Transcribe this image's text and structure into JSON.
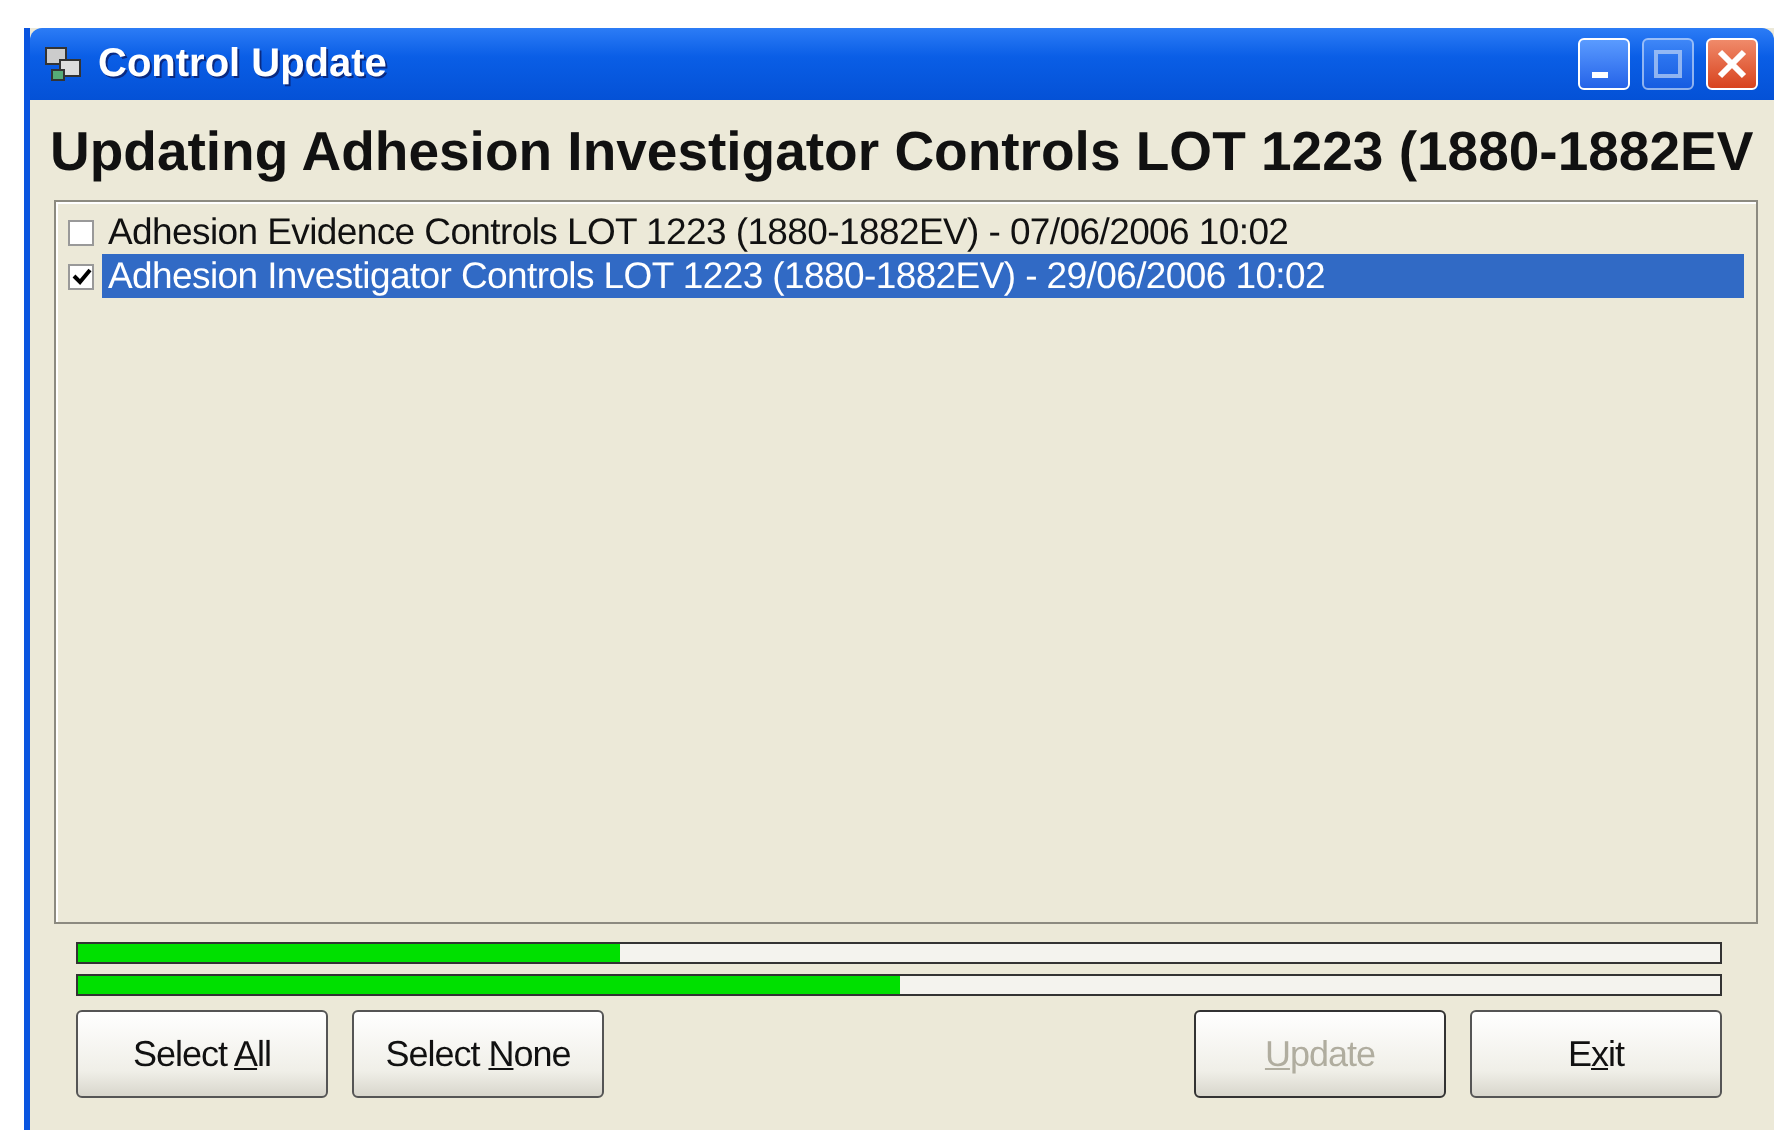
{
  "window": {
    "title": "Control Update",
    "maximize_disabled": true
  },
  "heading": "Updating Adhesion Investigator Controls LOT 1223 (1880-1882EV",
  "items": [
    {
      "label": "Adhesion Evidence Controls LOT 1223 (1880-1882EV)  -  07/06/2006 10:02",
      "checked": false,
      "selected": false
    },
    {
      "label": "Adhesion Investigator Controls LOT 1223 (1880-1882EV)  -  29/06/2006 10:02",
      "checked": true,
      "selected": true
    }
  ],
  "progress": [
    {
      "level": 0.33
    },
    {
      "level": 0.5
    }
  ],
  "left_buttons": [
    {
      "before": "Select ",
      "access_key": "A",
      "after": "ll",
      "disabled": false
    },
    {
      "before": "Select ",
      "access_key": "N",
      "after": "one",
      "disabled": false
    }
  ],
  "right_buttons": [
    {
      "access_key": "U",
      "after": "pdate",
      "disabled": true
    },
    {
      "before": "E",
      "access_key": "x",
      "after": "it",
      "disabled": false
    }
  ]
}
